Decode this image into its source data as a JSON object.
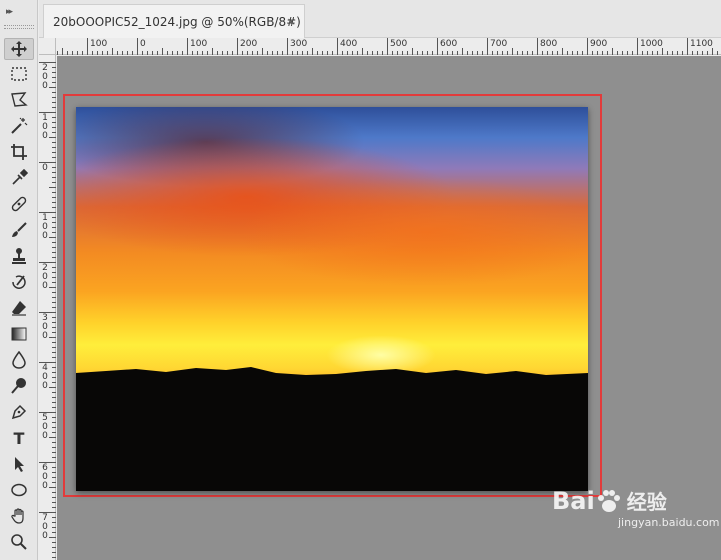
{
  "document_tab": {
    "title": "20bOOOPIC52_1024.jpg @ 50%(RGB/8#)",
    "close_glyph": "×"
  },
  "toolbar": {
    "collapse_glyph": "▸▸",
    "tools": [
      "move-tool",
      "rectangular-marquee-tool",
      "polygonal-lasso-tool",
      "magic-wand-tool",
      "crop-tool",
      "eyedropper-tool",
      "spot-healing-brush-tool",
      "brush-tool",
      "clone-stamp-tool",
      "history-brush-tool",
      "eraser-tool",
      "gradient-tool",
      "blur-tool",
      "dodge-tool",
      "pen-tool",
      "type-tool",
      "path-selection-tool",
      "ellipse-tool",
      "hand-tool",
      "zoom-tool"
    ],
    "type_tool_glyph": "T"
  },
  "ruler": {
    "horizontal_labels": [
      "100",
      "0",
      "100",
      "200",
      "300",
      "400",
      "500",
      "600",
      "700",
      "800",
      "900",
      "1000",
      "1100"
    ],
    "vertical_labels": [
      "2\n0\n0",
      "1\n0\n0",
      "0",
      "1\n0\n0",
      "2\n0\n0",
      "3\n0\n0",
      "4\n0\n0",
      "5\n0\n0",
      "6\n0\n0",
      "7\n0\n0"
    ]
  },
  "watermark": {
    "brand_left": "Bai",
    "brand_right": "经验",
    "subtitle": "jingyan.baidu.com"
  },
  "colors": {
    "highlight": "#e23b3b",
    "canvas": "#8f8f8f",
    "toolbar": "#e6e6e6"
  }
}
